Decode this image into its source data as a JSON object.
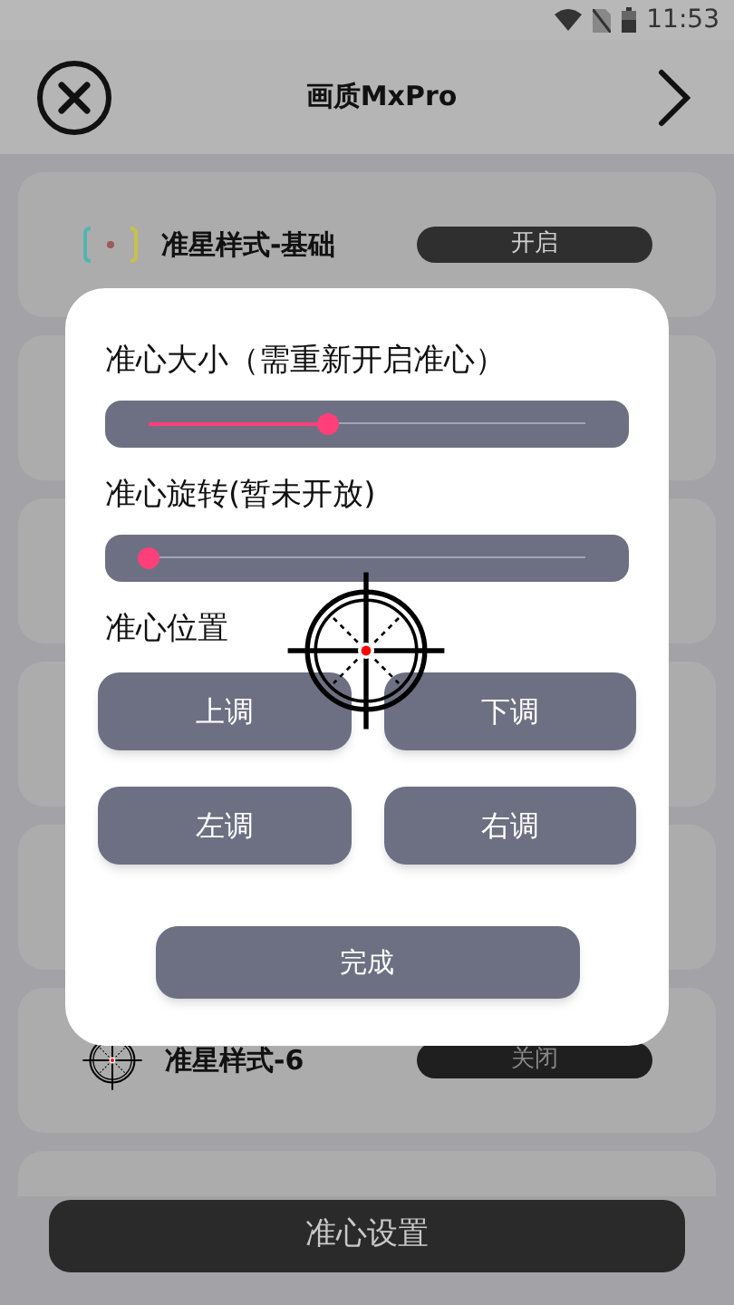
{
  "status_bar": {
    "time": "11:53"
  },
  "header": {
    "title": "画质MxPro"
  },
  "rows": [
    {
      "label": "准星样式-基础",
      "toggle": "开启",
      "kind": "basic",
      "on": true
    },
    {
      "label": "准星样式-6",
      "toggle": "关闭",
      "kind": "scope",
      "on": false
    }
  ],
  "dialog": {
    "sliders": [
      {
        "label": "准心大小（需重新开启准心）",
        "level": 0.41
      },
      {
        "label": "准心旋转(暂未开放)",
        "level": 0
      }
    ],
    "position_label": "准心位置",
    "buttons": [
      "上调",
      "下调",
      "左调",
      "右调"
    ],
    "done": "完成"
  },
  "bottom_button": "准心设置"
}
